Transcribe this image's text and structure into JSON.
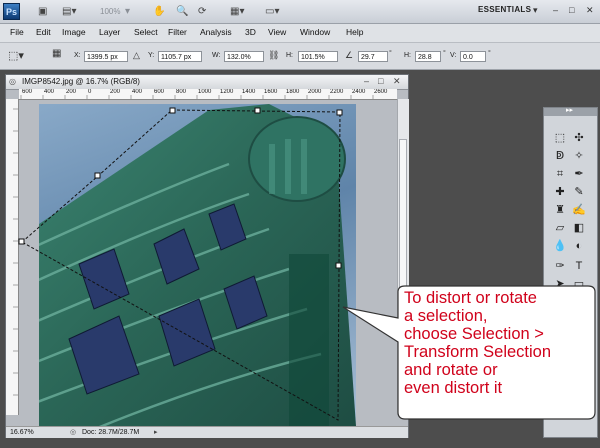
{
  "appbar": {
    "logo": "Ps",
    "zoom": "100%",
    "workspace": "ESSENTIALS"
  },
  "menu": [
    "File",
    "Edit",
    "Image",
    "Layer",
    "Select",
    "Filter",
    "Analysis",
    "3D",
    "View",
    "Window",
    "Help"
  ],
  "options": {
    "x_label": "X:",
    "x_value": "1399.5 px",
    "y_label": "Y:",
    "y_value": "1105.7 px",
    "w_label": "W:",
    "w_value": "132.0%",
    "h_label": "H:",
    "h_value": "101.5%",
    "angle_value": "29.7",
    "hskew_label": "H:",
    "hskew_value": "28.8",
    "vskew_label": "V:",
    "vskew_value": "0.0"
  },
  "document": {
    "title": "IMGP8542.jpg @ 16.7% (RGB/8)",
    "ruler_ticks": [
      "600",
      "400",
      "200",
      "0",
      "200",
      "400",
      "600",
      "800",
      "1000",
      "1200",
      "1400",
      "1600",
      "1800",
      "2000",
      "2200",
      "2400",
      "2600"
    ],
    "zoom": "16.67%",
    "doc_size": "Doc: 28.7M/28.7M"
  },
  "callout": {
    "lines": [
      "To distort or rotate",
      "a selection,",
      "choose Selection >",
      "Transform Selection",
      "and rotate or",
      "even distort it"
    ]
  },
  "colors": {
    "callout_text": "#d0021b",
    "callout_border": "#333333",
    "building": "#2f6e5e"
  }
}
